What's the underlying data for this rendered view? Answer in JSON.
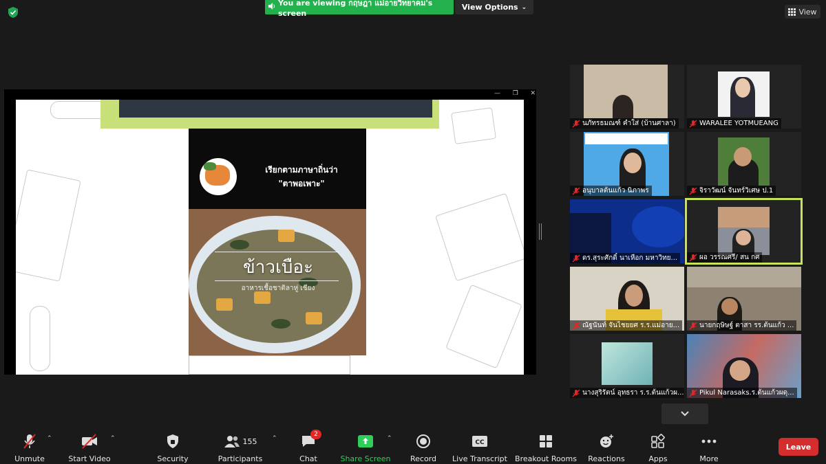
{
  "top": {
    "share_banner": "You are viewing กฤษฎา แม่อายวิทยาคม's screen",
    "view_options": "View Options",
    "view": "View"
  },
  "slide": {
    "local_name_line1": "เรียกตามภาษาถิ่นว่า",
    "local_name_line2": "\"ตาพอเพาะ\"",
    "dish_title": "ข้าวเบือะ",
    "dish_subtitle": "อาหารเชื้อชาติลาหู่ เชียง"
  },
  "gallery": {
    "participants": [
      {
        "name": "นภัทรธมณฑ์ คำใส่ (บ้านศาลา)"
      },
      {
        "name": "WARALEE YOTMUEANG"
      },
      {
        "name": "อนุบาลต้นแก้ว นิภาพร"
      },
      {
        "name": "จิราวัฒน์ จันทร์วิเศษ ป.1"
      },
      {
        "name": "ดร.สุระศักดิ์ นาเหือก มหาวิทย..."
      },
      {
        "name": "ผอ วรรณศรี/ สน กศ"
      },
      {
        "name": "ณัฐนันท์ จันไชยยศ ร.ร.แม่อาย..."
      },
      {
        "name": "นายกฤษิษฐ์ ตาสา รร.ต้นแก้ว ..."
      },
      {
        "name": "นางสุริรัตน์ อุทธรา ร.ร.ต้นแก้วผ..."
      },
      {
        "name": "Pikul Narasaks.ร.ต้นแก้วผดุ..."
      }
    ]
  },
  "toolbar": {
    "unmute": "Unmute",
    "start_video": "Start Video",
    "security": "Security",
    "participants": "Participants",
    "participants_count": "155",
    "chat": "Chat",
    "chat_badge": "2",
    "share_screen": "Share Screen",
    "record": "Record",
    "live_transcript": "Live Transcript",
    "breakout_rooms": "Breakout Rooms",
    "reactions": "Reactions",
    "apps": "Apps",
    "more": "More",
    "leave": "Leave",
    "cc": "CC"
  },
  "colors": {
    "share_green": "#22b14c",
    "active_speaker_border": "#c7e35a",
    "leave_red": "#d42d2d",
    "mic_off_red": "#e02828"
  }
}
